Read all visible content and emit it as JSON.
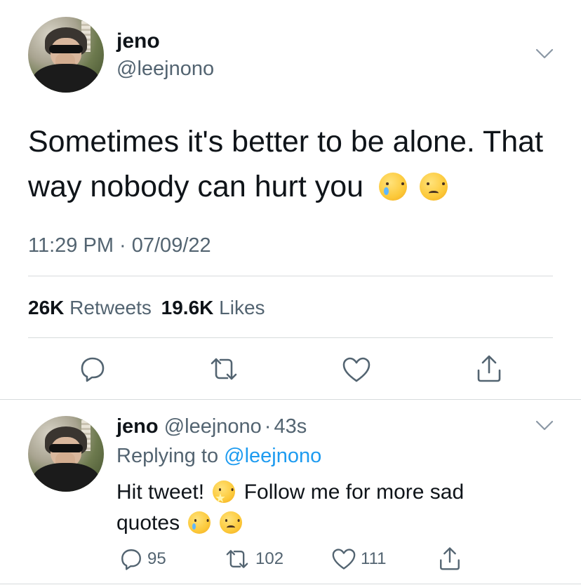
{
  "main_tweet": {
    "display_name": "jeno",
    "handle": "@leejnono",
    "text": "Sometimes it's better to be alone. That way nobody can hurt you",
    "timestamp": "11:29 PM · 07/09/22",
    "retweets_count": "26K",
    "retweets_label": "Retweets",
    "likes_count": "19.6K",
    "likes_label": "Likes",
    "actions": [
      "reply-icon",
      "retweet-icon",
      "like-icon",
      "share-icon"
    ]
  },
  "reply": {
    "display_name": "jeno",
    "handle": "@leejnono",
    "separator": "·",
    "age": "43s",
    "replying_prefix": "Replying to",
    "replying_to": "@leejnono",
    "text_1": "Hit tweet!",
    "text_2": "Follow me for more sad",
    "text_3": "quotes",
    "reply_count": "95",
    "retweet_count": "102",
    "like_count": "111"
  },
  "colors": {
    "text": "#0f1419",
    "muted": "#536471",
    "link": "#1d9bf0",
    "divider": "#d7dbdc"
  }
}
